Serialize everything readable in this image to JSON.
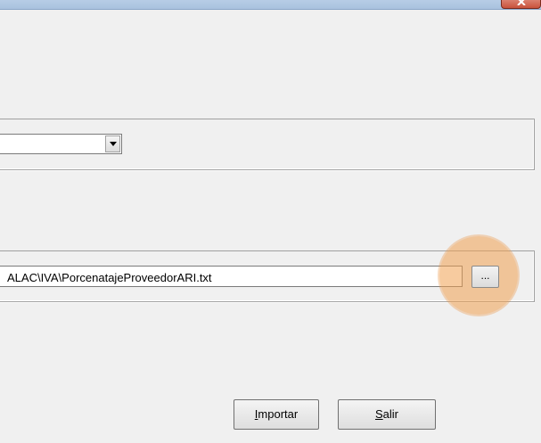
{
  "window": {
    "close_icon": "close-icon"
  },
  "source_combo": {
    "value": "",
    "dropdown_icon": "chevron-down-icon"
  },
  "file_path": {
    "value": "ALAC\\IVA\\PorcenatajeProveedorARI.txt",
    "browse_label": "..."
  },
  "buttons": {
    "importar_accel": "I",
    "importar_rest": "mportar",
    "salir_accel": "S",
    "salir_rest": "alir"
  },
  "highlight_color": "#f0a050"
}
